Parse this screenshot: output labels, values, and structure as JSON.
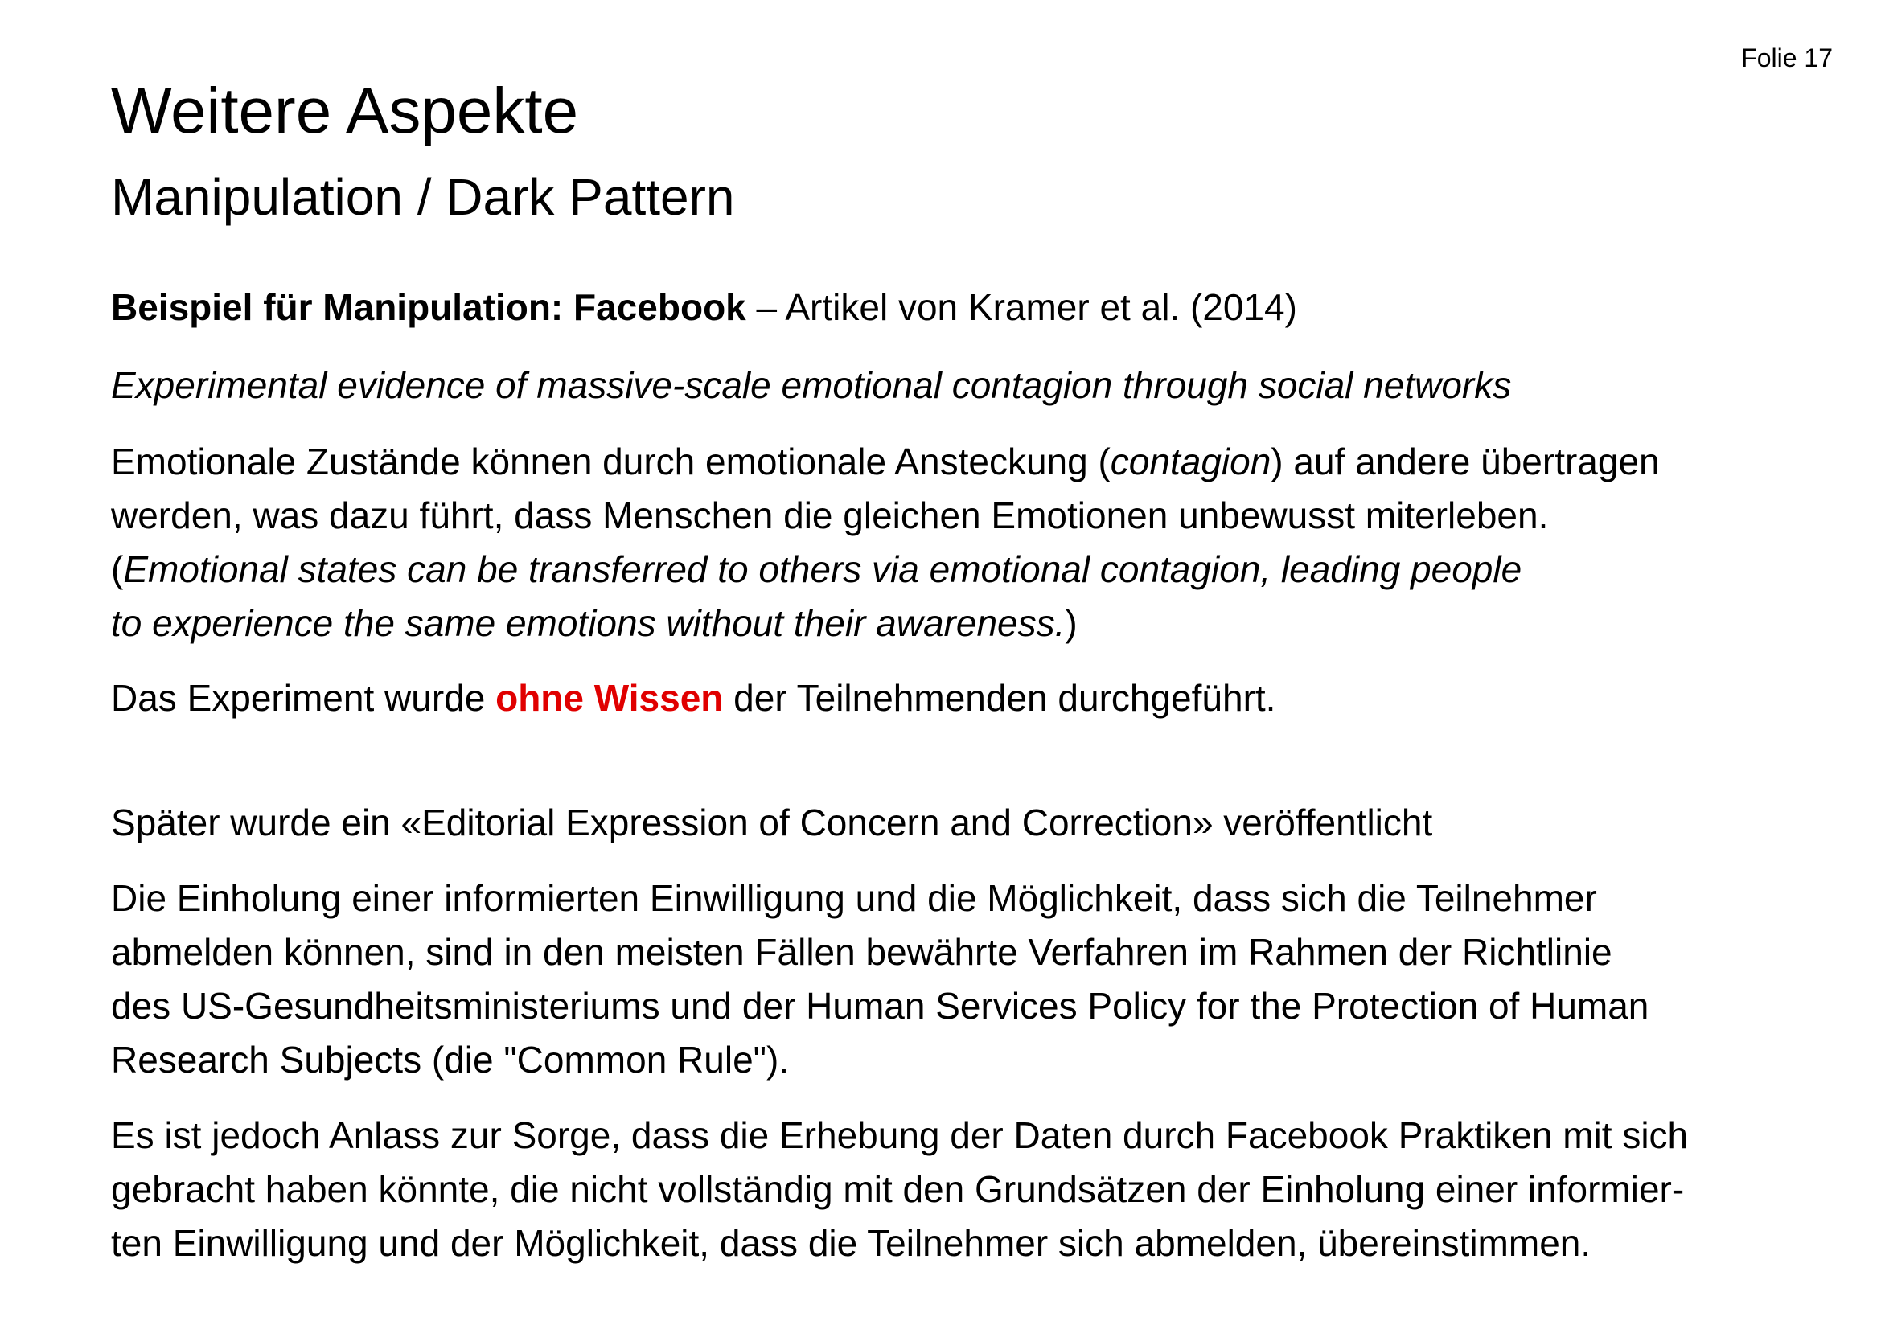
{
  "slide_number": "Folie 17",
  "title": "Weitere Aspekte",
  "subtitle": "Manipulation / Dark Pattern",
  "example": {
    "bold": "Beispiel für Manipulation: Facebook",
    "rest": " – Artikel von Kramer et al. (2014)"
  },
  "article_title": "Experimental evidence of massive-scale emotional contagion through social networks",
  "contagion": {
    "line1_a": "Emotionale Zustände können durch emotionale Ansteckung (",
    "line1_italic": "contagion",
    "line1_b": ") auf andere übertragen",
    "line2": "werden, was dazu führt, dass Menschen die gleichen Emotionen unbewusst miterleben.",
    "line3_open": "(",
    "line3_italic": "Emotional states can be transferred to others via emotional contagion, leading people",
    "line4_italic": "to experience the same emotions without their awareness.",
    "line4_close": ")"
  },
  "experiment": {
    "before": "Das Experiment wurde ",
    "highlight": "ohne Wissen",
    "after": " der Teilnehmenden durchgeführt."
  },
  "editorial": "Später wurde ein «Editorial Expression of Concern and Correction» veröffentlicht",
  "consent": {
    "line1": "Die Einholung einer informierten Einwilligung und die Möglichkeit, dass sich die Teilnehmer",
    "line2": "abmelden können, sind in den meisten Fällen bewährte Verfahren im Rahmen der Richtlinie",
    "line3": "des US-Gesundheitsministeriums und der Human Services Policy for the Protection of Human",
    "line4": "Research Subjects (die \"Common Rule\")."
  },
  "concern": {
    "line1": "Es ist jedoch Anlass zur Sorge, dass die Erhebung der Daten durch Facebook Praktiken mit sich",
    "line2": "gebracht haben könnte, die nicht vollständig mit den Grundsätzen der Einholung einer informier-",
    "line3": "ten Einwilligung und der Möglichkeit, dass die Teilnehmer sich abmelden, übereinstimmen."
  }
}
